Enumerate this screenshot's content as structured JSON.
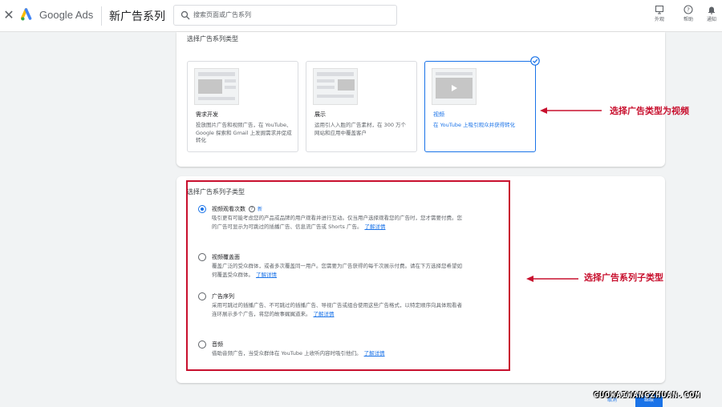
{
  "header": {
    "close_icon": "close-icon",
    "brand": "Google Ads",
    "page_title": "新广告系列",
    "search_placeholder": "搜索页面或广告系列",
    "tools": [
      {
        "icon": "palette-icon",
        "label": "外观"
      },
      {
        "icon": "help-icon",
        "label": "帮助"
      },
      {
        "icon": "bell-icon",
        "label": "通知"
      }
    ]
  },
  "campaign_type": {
    "heading": "选择广告系列类型",
    "cards": [
      {
        "title": "需求开发",
        "desc": "投放图片广告和视频广告，在 YouTube、Google 探索和 Gmail 上发掘需求并促成转化",
        "selected": false
      },
      {
        "title": "展示",
        "desc": "运用引人入胜的广告素材，在 300 万个网站和应用中覆盖客户",
        "selected": false
      },
      {
        "title": "视频",
        "desc": "在 YouTube 上吸引观众并获得转化",
        "selected": true
      }
    ]
  },
  "campaign_subtype": {
    "heading": "选择广告系列子类型",
    "options": [
      {
        "title": "视频观看次数",
        "badge": "新",
        "desc": "吸引更有可能考虑您的产品或品牌的用户观看并进行互动。仅当用户选择观看您的广告时，您才需要付费。您的广告可显示为可跳过的插播广告、信息流广告或 Shorts 广告。",
        "link": "了解详情",
        "checked": true
      },
      {
        "title": "视频覆盖面",
        "desc": "覆盖广泛的受众群体，或者多次覆盖同一用户。您需要为广告获得的每千次展示付费。请在下方选择您希望如何覆盖受众群体。",
        "link": "了解详情",
        "checked": false
      },
      {
        "title": "广告序列",
        "desc": "采用可跳过的插播广告、不可跳过的插播广告、导视广告或组合使用这些广告格式，以特定顺序向具体观看者连环展示多个广告，将您的故事娓娓道来。",
        "link": "了解详情",
        "checked": false
      },
      {
        "title": "音频",
        "desc": "借助音频广告，当受众群体在 YouTube 上收听内容时吸引他们。",
        "link": "了解详情",
        "checked": false
      }
    ]
  },
  "annotations": {
    "type_note": "选择广告类型为视频",
    "subtype_note": "选择广告系列子类型"
  },
  "footer": {
    "cancel": "取消",
    "next": "继续"
  },
  "watermark": "GUOWAIWANGZHUAN.COM",
  "colors": {
    "accent": "#1a73e8",
    "annotation": "#c8102e"
  }
}
